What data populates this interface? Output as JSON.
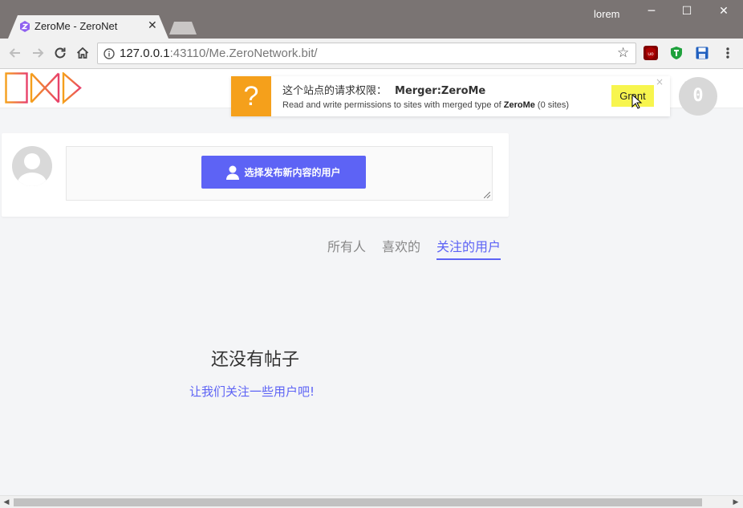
{
  "window": {
    "user": "lorem",
    "tab_title": "ZeroMe - ZeroNet"
  },
  "address": {
    "host": "127.0.0.1",
    "rest": ":43110/Me.ZeroNetwork.bit/"
  },
  "icons": {
    "back": "arrow-left-icon",
    "forward": "arrow-right-icon",
    "reload": "reload-icon",
    "home": "home-icon",
    "info": "info-icon",
    "star": "star-icon",
    "ublock": "ublock-icon",
    "extension2": "shield-extension-icon",
    "save": "floppy-disk-icon",
    "menu": "kebab-menu-icon"
  },
  "notification": {
    "question_mark": "?",
    "title": "这个站点的请求权限：",
    "permission": "Merger:ZeroMe",
    "desc_prefix": "Read and write permissions to sites with merged type of ",
    "desc_bold": "ZeroMe",
    "desc_suffix": " (0 sites)",
    "grant_label": "Grant",
    "close": "×"
  },
  "badge": {
    "count": "0"
  },
  "post": {
    "select_user_label": "选择发布新内容的用户"
  },
  "feed_tabs": [
    {
      "label": "所有人",
      "active": false
    },
    {
      "label": "喜欢的",
      "active": false
    },
    {
      "label": "关注的用户",
      "active": true
    }
  ],
  "empty": {
    "title": "还没有帖子",
    "link": "让我们关注一些用户吧!"
  },
  "colors": {
    "accent": "#5d63f5",
    "notification": "#f5a01b",
    "grant": "#f7f54e",
    "logo_from": "#f5a01b",
    "logo_to": "#e8416b"
  }
}
